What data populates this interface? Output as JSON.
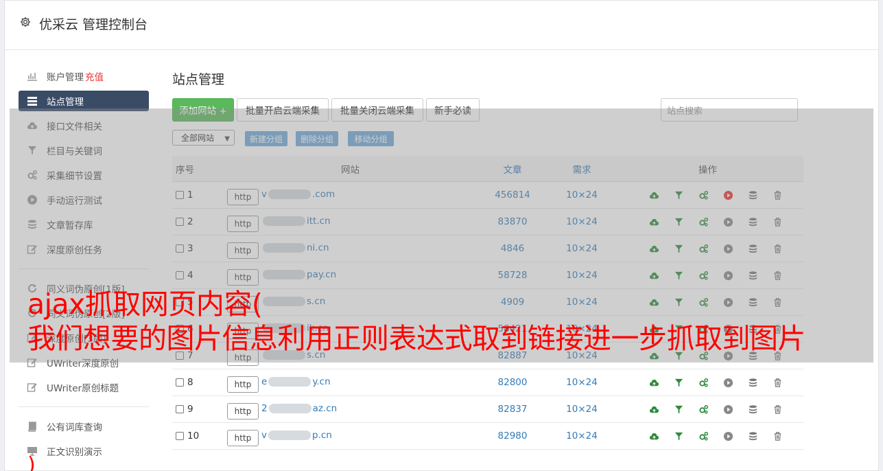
{
  "app": {
    "title": "优采云 管理控制台"
  },
  "sidebar": {
    "items": [
      {
        "label": "账户管理",
        "extra": "充值",
        "icon": "bar-chart-icon"
      },
      {
        "label": "站点管理",
        "icon": "server-list-icon",
        "active": true
      },
      {
        "label": "接口文件相关",
        "icon": "cloud-upload-icon"
      },
      {
        "label": "栏目与关键词",
        "icon": "filter-icon"
      },
      {
        "label": "采集细节设置",
        "icon": "cogs-icon"
      },
      {
        "label": "手动运行测试",
        "icon": "play-circle-icon"
      },
      {
        "label": "文章暂存库",
        "icon": "database-icon"
      },
      {
        "label": "深度原创任务",
        "icon": "edit-icon"
      }
    ],
    "group2": [
      {
        "label": "同义词伪原创[1版]",
        "icon": "refresh-icon"
      },
      {
        "label": "同义词伪原创[2版]",
        "icon": "refresh-icon"
      },
      {
        "label": "深度原创[3版]",
        "icon": "edit-icon"
      },
      {
        "label": "UWriter深度原创",
        "icon": "edit-icon"
      },
      {
        "label": "UWriter原创标题",
        "icon": "edit-icon"
      }
    ],
    "group3": [
      {
        "label": "公有词库查询",
        "icon": "book-icon"
      },
      {
        "label": "正文识别演示",
        "icon": "monitor-icon"
      }
    ]
  },
  "main": {
    "title": "站点管理",
    "toolbar": {
      "add_site": "添加网站 +",
      "batch_open": "批量开启云端采集",
      "batch_close": "批量关闭云端采集",
      "guide": "新手必读",
      "search_placeholder": "站点搜索"
    },
    "filter": {
      "select_value": "全部网站",
      "new_group": "新建分组",
      "delete_group": "删除分组",
      "move_group": "移动分组"
    },
    "table": {
      "headers": {
        "no": "序号",
        "site": "网站",
        "articles": "文章",
        "demand": "需求",
        "ops": "操作"
      },
      "http_label": "http",
      "rows": [
        {
          "no": "1",
          "site_prefix": "v",
          "site_suffix": ".com",
          "articles": "456814",
          "demand": "10×24",
          "running": true
        },
        {
          "no": "2",
          "site_prefix": "",
          "site_suffix": "itt.cn",
          "articles": "83870",
          "demand": "10×24",
          "running": false
        },
        {
          "no": "3",
          "site_prefix": "",
          "site_suffix": "ni.cn",
          "articles": "4846",
          "demand": "10×24",
          "running": false
        },
        {
          "no": "4",
          "site_prefix": "",
          "site_suffix": "pay.cn",
          "articles": "58728",
          "demand": "10×24",
          "running": false
        },
        {
          "no": "5",
          "site_prefix": "",
          "site_suffix": "s.cn",
          "articles": "4909",
          "demand": "10×24",
          "running": false
        },
        {
          "no": "6",
          "site_prefix": "",
          "site_suffix": "ik.cn",
          "articles": "58421",
          "demand": "10×24",
          "running": false
        },
        {
          "no": "7",
          "site_prefix": "",
          "site_suffix": "s.cn",
          "articles": "82887",
          "demand": "10×24",
          "running": false
        },
        {
          "no": "8",
          "site_prefix": "e",
          "site_suffix": "y.cn",
          "articles": "82800",
          "demand": "10×24",
          "running": false
        },
        {
          "no": "9",
          "site_prefix": "2",
          "site_suffix": "az.cn",
          "articles": "82837",
          "demand": "10×24",
          "running": false
        },
        {
          "no": "10",
          "site_prefix": "v",
          "site_suffix": "p.cn",
          "articles": "82980",
          "demand": "10×24",
          "running": false
        }
      ]
    }
  },
  "overlay": {
    "caption_line1": "ajax抓取网页内容(",
    "caption_line2": "我们想要的图片信息利用正则表达式取到链接进一步抓取到图片",
    "caption_tail": ")"
  },
  "colors": {
    "accent": "#3a4b66",
    "green": "#5cb85c",
    "link": "#337ab7",
    "caption": "#ff0000",
    "running": "#e33"
  }
}
